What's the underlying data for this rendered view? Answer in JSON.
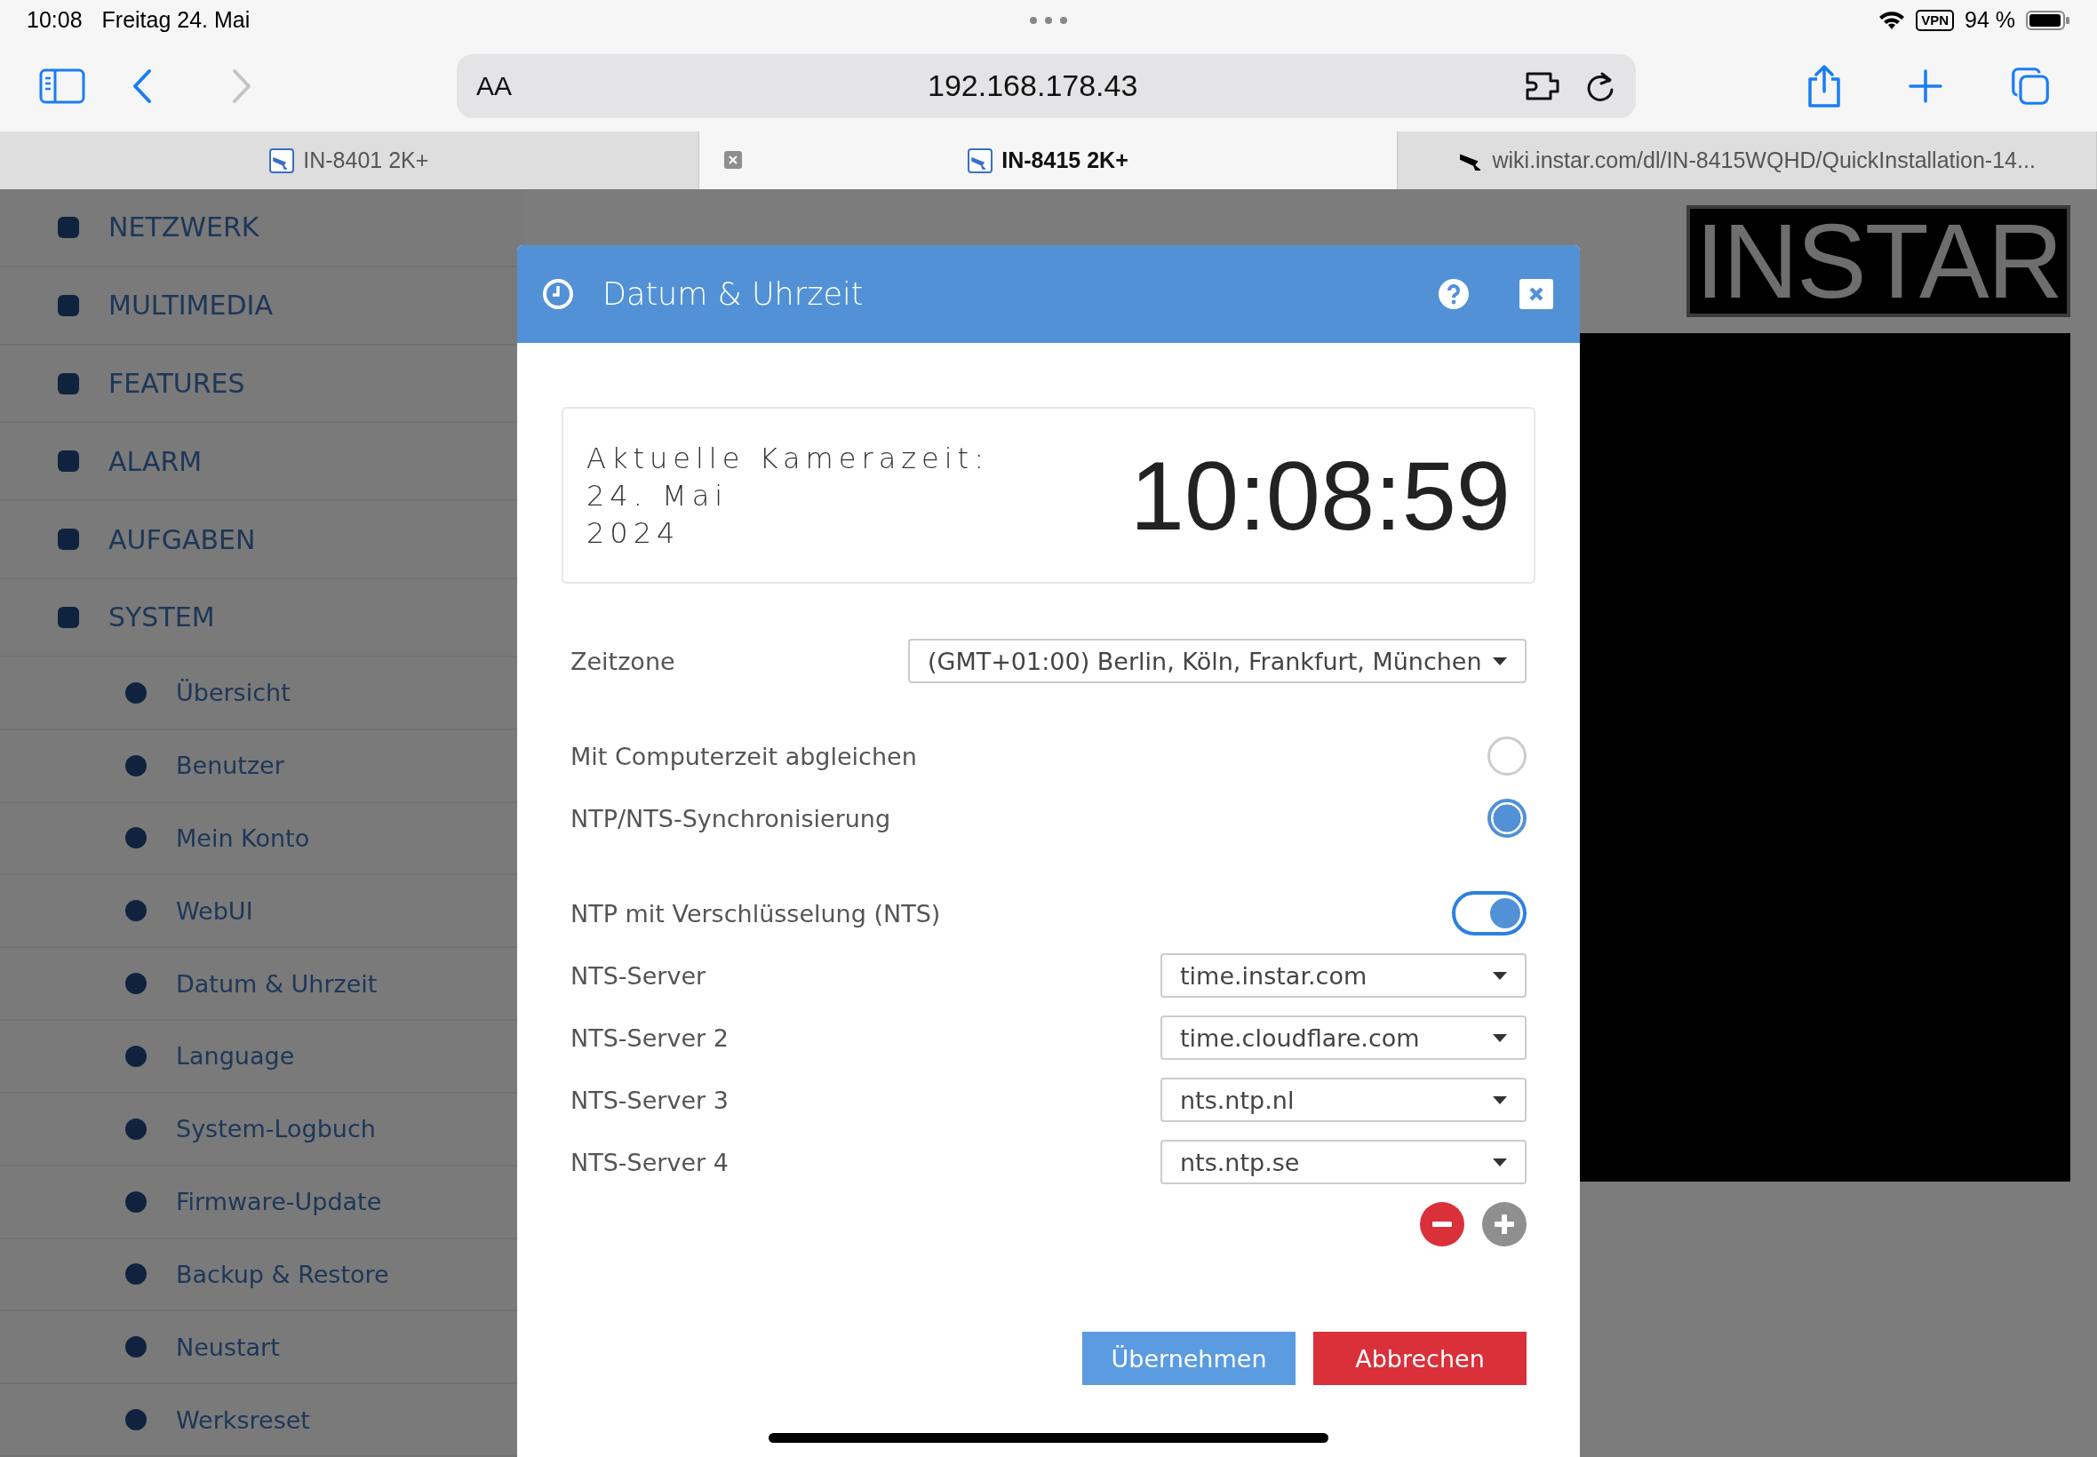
{
  "status_bar": {
    "time": "10:08",
    "date": "Freitag 24. Mai",
    "vpn": "VPN",
    "battery": "94 %"
  },
  "browser": {
    "text_size": "AA",
    "url": "192.168.178.43"
  },
  "tabs": [
    {
      "label": "IN-8401 2K+",
      "selected": false,
      "kind": "camera"
    },
    {
      "label": "IN-8415 2K+",
      "selected": true,
      "kind": "camera"
    },
    {
      "label": "wiki.instar.com/dl/IN-8415WQHD/QuickInstallation-14...",
      "selected": false,
      "kind": "wiki"
    }
  ],
  "sidebar": {
    "items": [
      {
        "label": "NETZWERK"
      },
      {
        "label": "MULTIMEDIA"
      },
      {
        "label": "FEATURES"
      },
      {
        "label": "ALARM"
      },
      {
        "label": "AUFGABEN"
      },
      {
        "label": "SYSTEM",
        "children": [
          {
            "label": "Übersicht"
          },
          {
            "label": "Benutzer"
          },
          {
            "label": "Mein Konto"
          },
          {
            "label": "WebUI"
          },
          {
            "label": "Datum & Uhrzeit"
          },
          {
            "label": "Language"
          },
          {
            "label": "System-Logbuch"
          },
          {
            "label": "Firmware-Update"
          },
          {
            "label": "Backup & Restore"
          },
          {
            "label": "Neustart"
          },
          {
            "label": "Werksreset"
          }
        ]
      }
    ]
  },
  "logo": "INSTAR",
  "dialog": {
    "title": "Datum & Uhrzeit",
    "camera_time": {
      "label": "Aktuelle Kamerazeit:",
      "date": "24. Mai",
      "year": "2024",
      "time": "10:08:59"
    },
    "timezone": {
      "label": "Zeitzone",
      "value": "(GMT+01:00) Berlin, Köln, Frankfurt, München"
    },
    "sync_options": [
      {
        "label": "Mit Computerzeit abgleichen",
        "selected": false
      },
      {
        "label": "NTP/NTS-Synchronisierung",
        "selected": true
      }
    ],
    "nts_toggle": {
      "label": "NTP mit Verschlüsselung (NTS)",
      "on": true
    },
    "servers": [
      {
        "label": "NTS-Server",
        "value": "time.instar.com"
      },
      {
        "label": "NTS-Server 2",
        "value": "time.cloudflare.com"
      },
      {
        "label": "NTS-Server 3",
        "value": "nts.ntp.nl"
      },
      {
        "label": "NTS-Server 4",
        "value": "nts.ntp.se"
      }
    ],
    "buttons": {
      "apply": "Übernehmen",
      "cancel": "Abbrechen"
    }
  }
}
